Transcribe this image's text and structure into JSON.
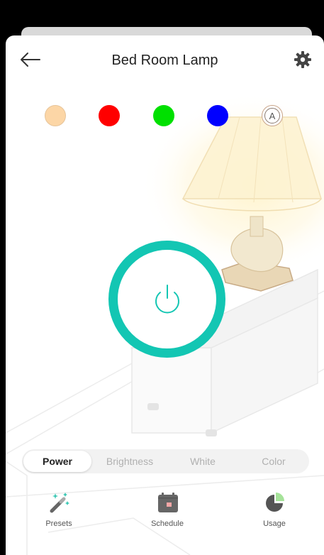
{
  "header": {
    "title": "Bed Room Lamp",
    "back_icon": "arrow-left-icon",
    "settings_icon": "gear-icon"
  },
  "color_presets": [
    {
      "name": "warm-white",
      "color": "#fcd6a6"
    },
    {
      "name": "red",
      "color": "#ff0000"
    },
    {
      "name": "green",
      "color": "#00e000"
    },
    {
      "name": "blue",
      "color": "#0000ff"
    }
  ],
  "auto_preset": {
    "label": "A"
  },
  "power_button": {
    "accent": "#13c6b3",
    "icon": "power-icon"
  },
  "tabs": [
    {
      "label": "Power",
      "active": true
    },
    {
      "label": "Brightness",
      "active": false
    },
    {
      "label": "White",
      "active": false
    },
    {
      "label": "Color",
      "active": false
    }
  ],
  "bottom_nav": [
    {
      "label": "Presets",
      "icon": "magic-wand-icon"
    },
    {
      "label": "Schedule",
      "icon": "calendar-icon"
    },
    {
      "label": "Usage",
      "icon": "pie-chart-icon"
    }
  ]
}
